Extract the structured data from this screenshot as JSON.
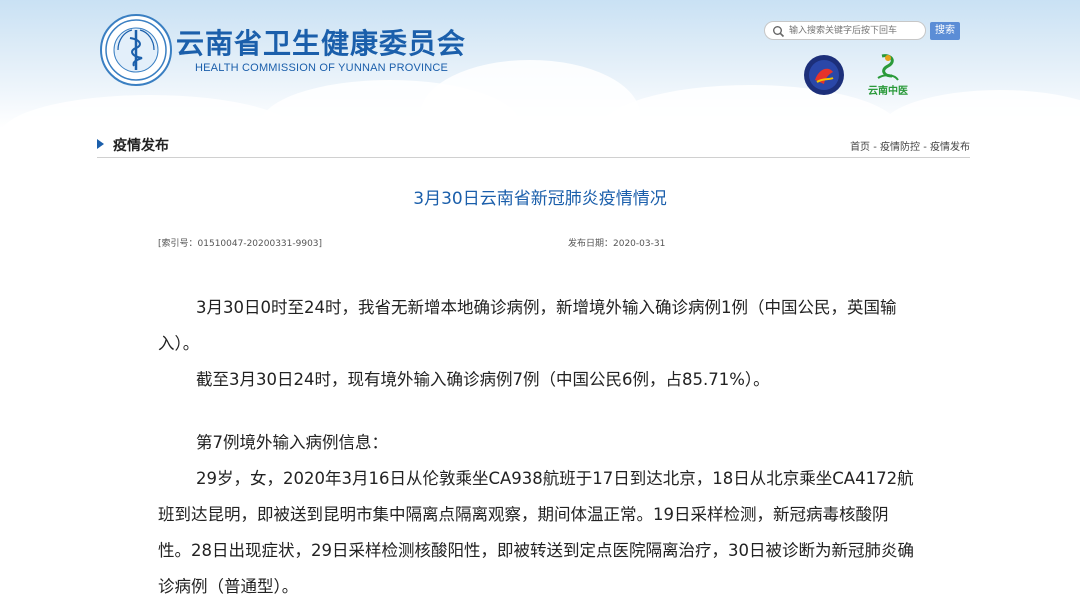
{
  "header": {
    "site_title": "云南省卫生健康委员会",
    "site_subtitle": "HEALTH COMMISSION OF YUNNAN PROVINCE",
    "search": {
      "placeholder": "输入搜索关键字后按下回车",
      "button_label": "搜索"
    },
    "logo2_text": "云南中医"
  },
  "section": {
    "title": "疫情发布",
    "breadcrumb": [
      "首页",
      "疫情防控",
      "疫情发布"
    ],
    "breadcrumb_separator": " - "
  },
  "article": {
    "title": "3月30日云南省新冠肺炎疫情情况",
    "index_no": "[索引号：01510047-20200331-9903]",
    "publish_date": "发布日期：2020-03-31",
    "paragraphs": [
      "3月30日0时至24时，我省无新增本地确诊病例，新增境外输入确诊病例1例（中国公民，英国输入）。",
      "截至3月30日24时，现有境外输入确诊病例7例（中国公民6例，占85.71%）。",
      "第7例境外输入病例信息：",
      "29岁，女，2020年3月16日从伦敦乘坐CA938航班于17日到达北京，18日从北京乘坐CA4172航班到达昆明，即被送到昆明市集中隔离点隔离观察，期间体温正常。19日采样检测，新冠病毒核酸阴性。28日出现症状，29日采样检测核酸阳性，即被转送到定点医院隔离治疗，30日被诊断为新冠肺炎确诊病例（普通型）。"
    ]
  },
  "colors": {
    "brand_blue": "#1b5fab",
    "search_button": "#5b8dd6",
    "green": "#2a9a3a"
  }
}
